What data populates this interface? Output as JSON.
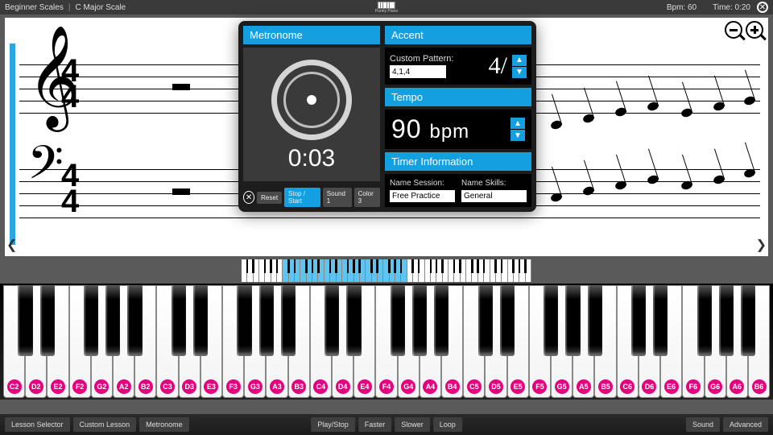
{
  "topbar": {
    "lesson_group": "Beginner Scales",
    "lesson_name": "C Major Scale",
    "brand": "Purely Piano",
    "bpm_label": "Bpm:",
    "bpm_value": "60",
    "time_label": "Time:",
    "time_value": "0:20"
  },
  "zoom": {
    "out": "−",
    "in": "+"
  },
  "time_signature": {
    "top": "4",
    "bottom": "4"
  },
  "panel": {
    "metronome_header": "Metronome",
    "timer": "0:03",
    "buttons": {
      "reset": "Reset",
      "stopstart": "Stop / Start",
      "sound": "Sound 1",
      "color": "Color 3"
    },
    "accent": {
      "header": "Accent",
      "pattern_label": "Custom Pattern:",
      "pattern_value": "4,1,4",
      "display": "4/"
    },
    "tempo": {
      "header": "Tempo",
      "value": "90",
      "unit": "bpm"
    },
    "timer_info": {
      "header": "Timer Information",
      "session_label": "Name Session:",
      "session_value": "Free Practice",
      "skills_label": "Name Skills:",
      "skills_value": "General"
    }
  },
  "keyboard_labels": [
    "C2",
    "D2",
    "E2",
    "F2",
    "G2",
    "A2",
    "B2",
    "C3",
    "D3",
    "E3",
    "F3",
    "G3",
    "A3",
    "B3",
    "C4",
    "D4",
    "E4",
    "F4",
    "G4",
    "A4",
    "B4",
    "C5",
    "D5",
    "E5",
    "F5",
    "G5",
    "A5",
    "B5",
    "C6",
    "D6",
    "E6",
    "F6",
    "G6",
    "A6",
    "B6"
  ],
  "footer": {
    "left": {
      "lesson_selector": "Lesson Selector",
      "custom_lesson": "Custom Lesson",
      "metronome": "Metronome"
    },
    "center": {
      "playstop": "Play/Stop",
      "faster": "Faster",
      "slower": "Slower",
      "loop": "Loop"
    },
    "right": {
      "sound": "Sound",
      "advanced": "Advanced"
    }
  }
}
